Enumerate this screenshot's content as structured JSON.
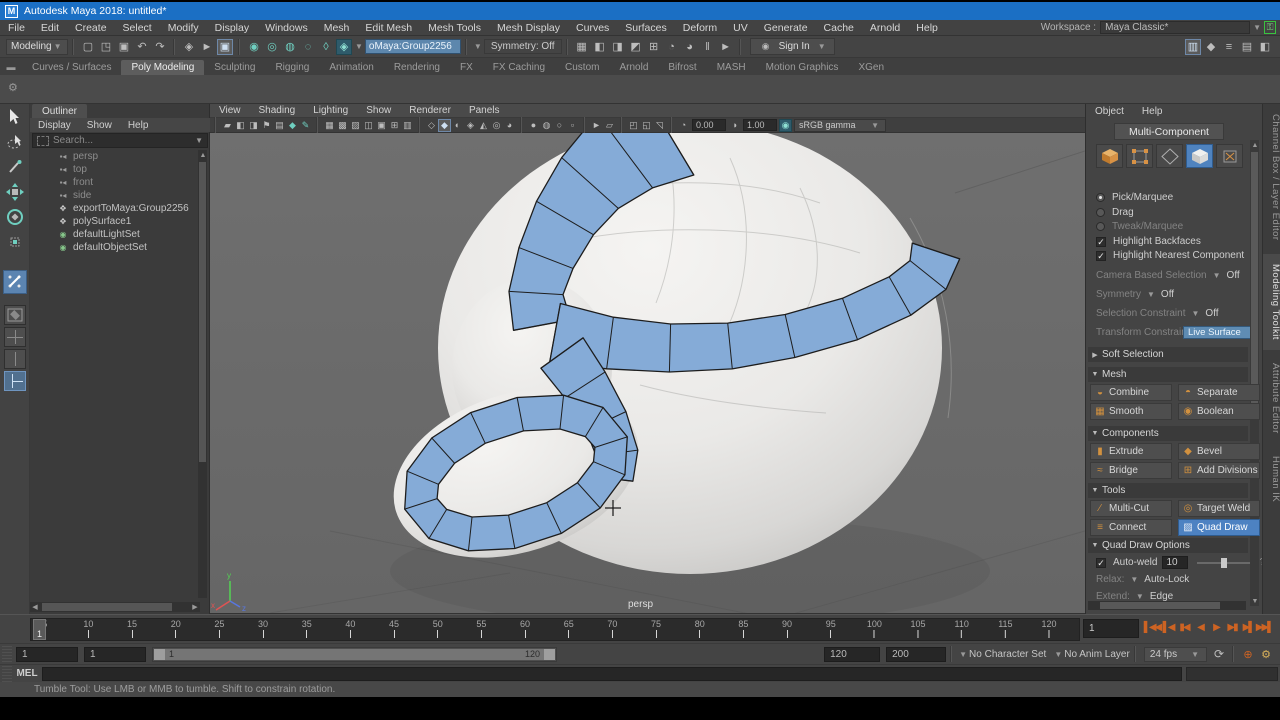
{
  "title_bar": {
    "title": "Autodesk Maya 2018: untitled*"
  },
  "window_controls": [
    {
      "n": "minimize",
      "g": "–"
    },
    {
      "n": "maximize",
      "g": "□"
    },
    {
      "n": "close",
      "g": "✕"
    }
  ],
  "menu_bar": {
    "items": [
      "File",
      "Edit",
      "Create",
      "Select",
      "Modify",
      "Display",
      "Windows",
      "Mesh",
      "Edit Mesh",
      "Mesh Tools",
      "Mesh Display",
      "Curves",
      "Surfaces",
      "Deform",
      "UV",
      "Generate",
      "Cache",
      "Arnold",
      "Help"
    ],
    "workspace_label": "Workspace :",
    "workspace_value": "Maya Classic*"
  },
  "status_line": {
    "mode": "Modeling",
    "field_value": "oMaya:Group2256",
    "symmetry": "Symmetry: Off",
    "sign_in": "Sign In",
    "icons_file": [
      {
        "n": "new-scene",
        "g": "▢"
      },
      {
        "n": "open-scene",
        "g": "◳"
      },
      {
        "n": "save-scene",
        "g": "▣"
      },
      {
        "n": "undo",
        "g": "↶"
      },
      {
        "n": "redo",
        "g": "↷"
      }
    ],
    "icons_select": [
      {
        "n": "select-by-hierarchy",
        "g": "◈"
      },
      {
        "n": "select-by-object",
        "g": "►"
      },
      {
        "n": "select-by-component",
        "g": "▣",
        "c": "a"
      }
    ],
    "icons_snap": [
      {
        "n": "snap-to-grid",
        "g": "◉",
        "c": "t"
      },
      {
        "n": "snap-to-curve",
        "g": "◎",
        "c": "t"
      },
      {
        "n": "snap-to-point",
        "g": "◍",
        "c": "t"
      },
      {
        "n": "snap-to-projected-center",
        "g": "◌",
        "c": "t"
      },
      {
        "n": "snap-to-view-plane",
        "g": "◊",
        "c": "t"
      },
      {
        "n": "make-live",
        "g": "◈",
        "c": "ta"
      }
    ],
    "icons_render": [
      {
        "n": "render-settings",
        "g": "▦"
      },
      {
        "n": "render-current-frame",
        "g": "◧"
      },
      {
        "n": "ipr-render",
        "g": "◨"
      },
      {
        "n": "render-sequence",
        "g": "◩"
      },
      {
        "n": "hypershade",
        "g": "⊞"
      },
      {
        "n": "render-view",
        "g": "◔"
      },
      {
        "n": "light-editor",
        "g": "◕"
      },
      {
        "n": "pause-viewport",
        "g": "‖"
      },
      {
        "n": "interactive-playback",
        "g": "►"
      }
    ],
    "icons_right": [
      {
        "n": "modeling-toolkit-toggle",
        "g": "▥",
        "c": "a"
      },
      {
        "n": "humanik-toggle",
        "g": "◆"
      },
      {
        "n": "channel-box-toggle",
        "g": "≡"
      },
      {
        "n": "attribute-editor-toggle",
        "g": "▤"
      },
      {
        "n": "tool-settings-toggle",
        "g": "◧"
      }
    ]
  },
  "shelf": {
    "tabs": [
      {
        "label": "Curves / Surfaces"
      },
      {
        "label": "Poly Modeling",
        "active": true
      },
      {
        "label": "Sculpting"
      },
      {
        "label": "Rigging"
      },
      {
        "label": "Animation"
      },
      {
        "label": "Rendering"
      },
      {
        "label": "FX"
      },
      {
        "label": "FX Caching"
      },
      {
        "label": "Custom"
      },
      {
        "label": "Arnold"
      },
      {
        "label": "Bifrost"
      },
      {
        "label": "MASH"
      },
      {
        "label": "Motion Graphics"
      },
      {
        "label": "XGen"
      }
    ]
  },
  "outliner": {
    "tab": "Outliner",
    "menus": [
      "Display",
      "Show",
      "Help"
    ],
    "search_placeholder": "Search...",
    "items": [
      {
        "label": "persp",
        "type": "cam",
        "dim": true
      },
      {
        "label": "top",
        "type": "cam",
        "dim": true
      },
      {
        "label": "front",
        "type": "cam",
        "dim": true
      },
      {
        "label": "side",
        "type": "cam",
        "dim": true
      },
      {
        "label": "exportToMaya:Group2256",
        "type": "tr"
      },
      {
        "label": "polySurface1",
        "type": "tr"
      },
      {
        "label": "defaultLightSet",
        "type": "set"
      },
      {
        "label": "defaultObjectSet",
        "type": "set"
      }
    ]
  },
  "viewport": {
    "menus": [
      "View",
      "Shading",
      "Lighting",
      "Show",
      "Renderer",
      "Panels"
    ],
    "icons_cam": [
      {
        "n": "select-camera",
        "g": "▰"
      },
      {
        "n": "lock-camera",
        "g": "◧"
      },
      {
        "n": "camera-attributes",
        "g": "◨"
      },
      {
        "n": "bookmark",
        "g": "⚑"
      },
      {
        "n": "image-plane",
        "g": "▤"
      },
      {
        "n": "two-d-pan-zoom",
        "g": "◆",
        "c": "t"
      },
      {
        "n": "grease-pencil",
        "g": "✎",
        "c": "t"
      }
    ],
    "icons_shade": [
      {
        "n": "wireframe",
        "g": "▦"
      },
      {
        "n": "smooth-shade",
        "g": "▩"
      },
      {
        "n": "shade-all",
        "g": "▨"
      },
      {
        "n": "wireframe-on-shaded",
        "g": "◫"
      },
      {
        "n": "textured",
        "g": "▣"
      },
      {
        "n": "use-all-lights",
        "g": "⊞"
      },
      {
        "n": "textured-detail",
        "g": "▥"
      }
    ],
    "icons_light": [
      {
        "n": "isolate-select",
        "g": "◇"
      },
      {
        "n": "xray",
        "g": "◆",
        "c": "a"
      },
      {
        "n": "xray-joints",
        "g": "◐"
      },
      {
        "n": "xray-active",
        "g": "◈"
      },
      {
        "n": "backface-culling",
        "g": "◭"
      },
      {
        "n": "lighting",
        "g": "◎"
      },
      {
        "n": "shadows",
        "g": "◕"
      }
    ],
    "icons_post": [
      {
        "n": "occlusion",
        "g": "●"
      },
      {
        "n": "motion-blur",
        "g": "◍"
      },
      {
        "n": "multisample",
        "g": "○"
      },
      {
        "n": "depth-peeling",
        "g": "▫"
      }
    ],
    "icons_misc": [
      {
        "n": "paint-select",
        "g": "►"
      },
      {
        "n": "symmetry-view",
        "g": "▱"
      }
    ],
    "icons_pane": [
      {
        "n": "single-pane",
        "g": "◰"
      },
      {
        "n": "book-pane",
        "g": "◱"
      },
      {
        "n": "maximize-pane",
        "g": "◹"
      }
    ],
    "exposure_label": "0.00",
    "gamma_label": "1.00",
    "color_mgmt": "sRGB gamma",
    "camera_label": "persp",
    "axis": {
      "x": "x",
      "y": "y",
      "z": "z"
    }
  },
  "toolkit": {
    "menus": [
      "Object",
      "Help"
    ],
    "mode_button": "Multi-Component",
    "opts": {
      "pick": "Pick/Marquee",
      "drag": "Drag",
      "tweak": "Tweak/Marquee",
      "hb": "Highlight Backfaces",
      "hnc": "Highlight Nearest Component",
      "cbs": "Camera Based Selection",
      "cbs_val": "Off",
      "sym": "Symmetry",
      "sym_val": "Off",
      "sc": "Selection Constraint",
      "sc_val": "Off",
      "tc": "Transform Constraint",
      "tc_val": "Live Surface"
    },
    "sections": {
      "soft": "Soft Selection",
      "mesh": "Mesh",
      "components": "Components",
      "tools": "Tools",
      "qdo": "Quad Draw Options"
    },
    "mesh_buttons": [
      {
        "label": "Combine",
        "g": "◒"
      },
      {
        "label": "Separate",
        "g": "◓"
      },
      {
        "label": "Smooth",
        "g": "▦"
      },
      {
        "label": "Boolean",
        "g": "◉"
      }
    ],
    "comp_buttons": [
      {
        "label": "Extrude",
        "g": "▮"
      },
      {
        "label": "Bevel",
        "g": "◆"
      },
      {
        "label": "Bridge",
        "g": "≈"
      },
      {
        "label": "Add Divisions",
        "g": "⊞"
      }
    ],
    "tool_buttons": [
      {
        "label": "Multi-Cut",
        "g": "∕"
      },
      {
        "label": "Target Weld",
        "g": "◎"
      },
      {
        "label": "Connect",
        "g": "≡"
      },
      {
        "label": "Quad Draw",
        "g": "▨",
        "active": true
      }
    ],
    "qdo": {
      "autoweld": "Auto-weld",
      "autoweld_val": "10",
      "help": "?",
      "relax": "Relax:",
      "relax_val": "Auto-Lock",
      "extend": "Extend:",
      "extend_val": "Edge"
    }
  },
  "right_tabs": [
    {
      "label": "Channel Box / Layer Editor"
    },
    {
      "label": "Modeling Toolkit",
      "active": true
    },
    {
      "label": "Attribute Editor"
    },
    {
      "label": "Human IK"
    }
  ],
  "timeline": {
    "tick_labels": [
      "5",
      "10",
      "15",
      "20",
      "25",
      "30",
      "35",
      "40",
      "45",
      "50",
      "55",
      "60",
      "65",
      "70",
      "75",
      "80",
      "85",
      "90",
      "95",
      "100",
      "105",
      "110",
      "115",
      "120"
    ],
    "current_frame": "1",
    "playback": [
      {
        "n": "go-to-start",
        "g": "▌◀◀"
      },
      {
        "n": "step-back-frame",
        "g": "▌◀"
      },
      {
        "n": "step-back-key",
        "g": "▮◀"
      },
      {
        "n": "play-backwards",
        "g": "◀"
      },
      {
        "n": "play-forwards",
        "g": "▶"
      },
      {
        "n": "step-forward-key",
        "g": "▶▮"
      },
      {
        "n": "step-forward-frame",
        "g": "▶▌"
      },
      {
        "n": "go-to-end",
        "g": "▶▶▌"
      }
    ],
    "start_field": "1",
    "start_field2": "1",
    "bar_start": "1",
    "bar_end": "120",
    "end_field": "120",
    "end_field2": "200",
    "character_set": "No Character Set",
    "anim_layer": "No Anim Layer",
    "fps": "24 fps"
  },
  "command_line": {
    "label": "MEL"
  },
  "help_line": {
    "text": "Tumble Tool: Use LMB or MMB to tumble. Shift to constrain rotation."
  }
}
